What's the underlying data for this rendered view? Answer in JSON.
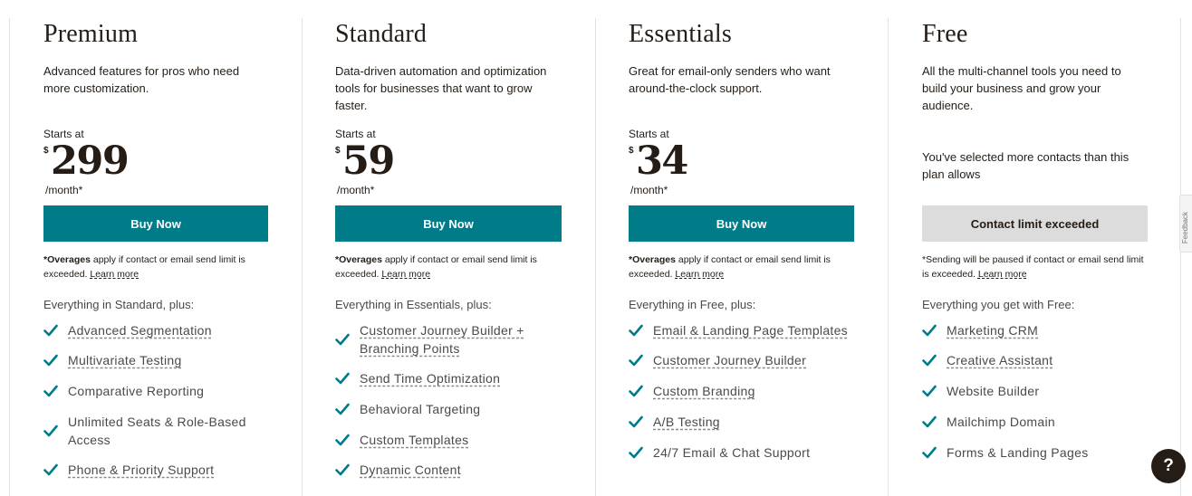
{
  "plans": [
    {
      "name": "Premium",
      "description": "Advanced features for pros who need more customization.",
      "starts_at": "Starts at",
      "currency": "$",
      "price": "299",
      "per_month": "/month*",
      "button": "Buy Now",
      "fine_bold": "*Overages",
      "fine_rest": " apply if contact or email send limit is exceeded. ",
      "learn_more": "Learn more",
      "everything": "Everything in Standard, plus:",
      "features": [
        {
          "label": "Advanced Segmentation",
          "link": true
        },
        {
          "label": "Multivariate Testing",
          "link": true
        },
        {
          "label": "Comparative Reporting",
          "link": false
        },
        {
          "label": "Unlimited Seats & Role-Based Access",
          "link": false
        },
        {
          "label": "Phone & Priority Support",
          "link": true
        }
      ]
    },
    {
      "name": "Standard",
      "description": "Data-driven automation and optimization tools for businesses that want to grow faster.",
      "starts_at": "Starts at",
      "currency": "$",
      "price": "59",
      "per_month": "/month*",
      "button": "Buy Now",
      "fine_bold": "*Overages",
      "fine_rest": " apply if contact or email send limit is exceeded. ",
      "learn_more": "Learn more",
      "everything": "Everything in Essentials, plus:",
      "features": [
        {
          "label": "Customer Journey Builder + Branching Points",
          "link": true
        },
        {
          "label": "Send Time Optimization",
          "link": true
        },
        {
          "label": "Behavioral Targeting",
          "link": false
        },
        {
          "label": "Custom Templates",
          "link": true
        },
        {
          "label": "Dynamic Content",
          "link": true
        }
      ]
    },
    {
      "name": "Essentials",
      "description": "Great for email-only senders who want around-the-clock support.",
      "starts_at": "Starts at",
      "currency": "$",
      "price": "34",
      "per_month": "/month*",
      "button": "Buy Now",
      "fine_bold": "*Overages",
      "fine_rest": " apply if contact or email send limit is exceeded. ",
      "learn_more": "Learn more",
      "everything": "Everything in Free, plus:",
      "features": [
        {
          "label": "Email & Landing Page Templates",
          "link": true
        },
        {
          "label": "Customer Journey Builder",
          "link": true
        },
        {
          "label": "Custom Branding",
          "link": true
        },
        {
          "label": "A/B Testing",
          "link": true
        },
        {
          "label": "24/7 Email & Chat Support",
          "link": false
        }
      ]
    },
    {
      "name": "Free",
      "description": "All the multi-channel tools you need to build your business and grow your audience.",
      "warning": "You've selected more contacts than this plan allows",
      "button": "Contact limit exceeded",
      "fine_text": "*Sending will be paused if contact or email send limit is exceeded. ",
      "learn_more": "Learn more",
      "everything": "Everything you get with Free:",
      "features": [
        {
          "label": "Marketing CRM",
          "link": true
        },
        {
          "label": "Creative Assistant",
          "link": true
        },
        {
          "label": "Website Builder",
          "link": false
        },
        {
          "label": "Mailchimp Domain",
          "link": false
        },
        {
          "label": "Forms & Landing Pages",
          "link": false
        }
      ]
    }
  ],
  "feedback_tab": "Feedback",
  "help_button": "?",
  "colors": {
    "accent": "#007c89",
    "text": "#241c15",
    "muted": "#4a4a4a",
    "disabled": "#dcdcdc"
  },
  "icons": {
    "check": "check-icon",
    "help": "question-mark-icon"
  }
}
